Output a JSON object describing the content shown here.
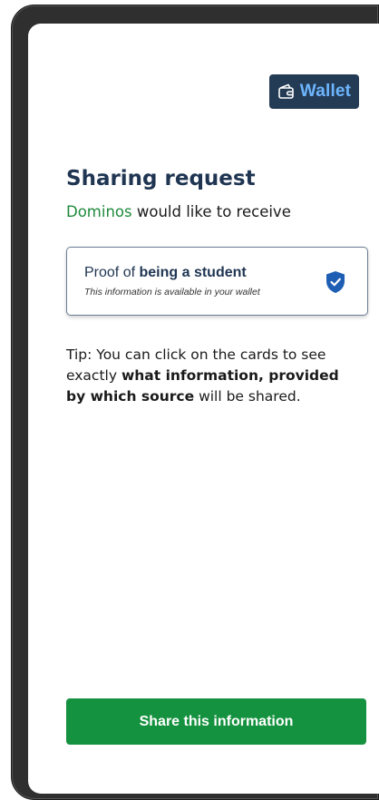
{
  "header": {
    "wallet_label": "Wallet",
    "wallet_icon": "wallet-icon"
  },
  "request": {
    "title": "Sharing request",
    "organization": "Dominos",
    "subtitle_rest": " would like to receive"
  },
  "card": {
    "title_prefix": "Proof of ",
    "title_bold": "being a student",
    "description": "This information is available in your wallet",
    "status_icon": "verified-shield-icon"
  },
  "tip": {
    "label": "Tip",
    "text_1": ": You can click on the cards to see exactly ",
    "text_bold": "what information, provided by which source",
    "text_2": " will be shared."
  },
  "actions": {
    "share_label": "Share this information"
  },
  "colors": {
    "wallet_bg": "#243b55",
    "wallet_text": "#6db6ff",
    "title": "#1f3552",
    "organization": "#1e8a3c",
    "primary_button": "#15923f",
    "shield": "#1e5fb4"
  }
}
